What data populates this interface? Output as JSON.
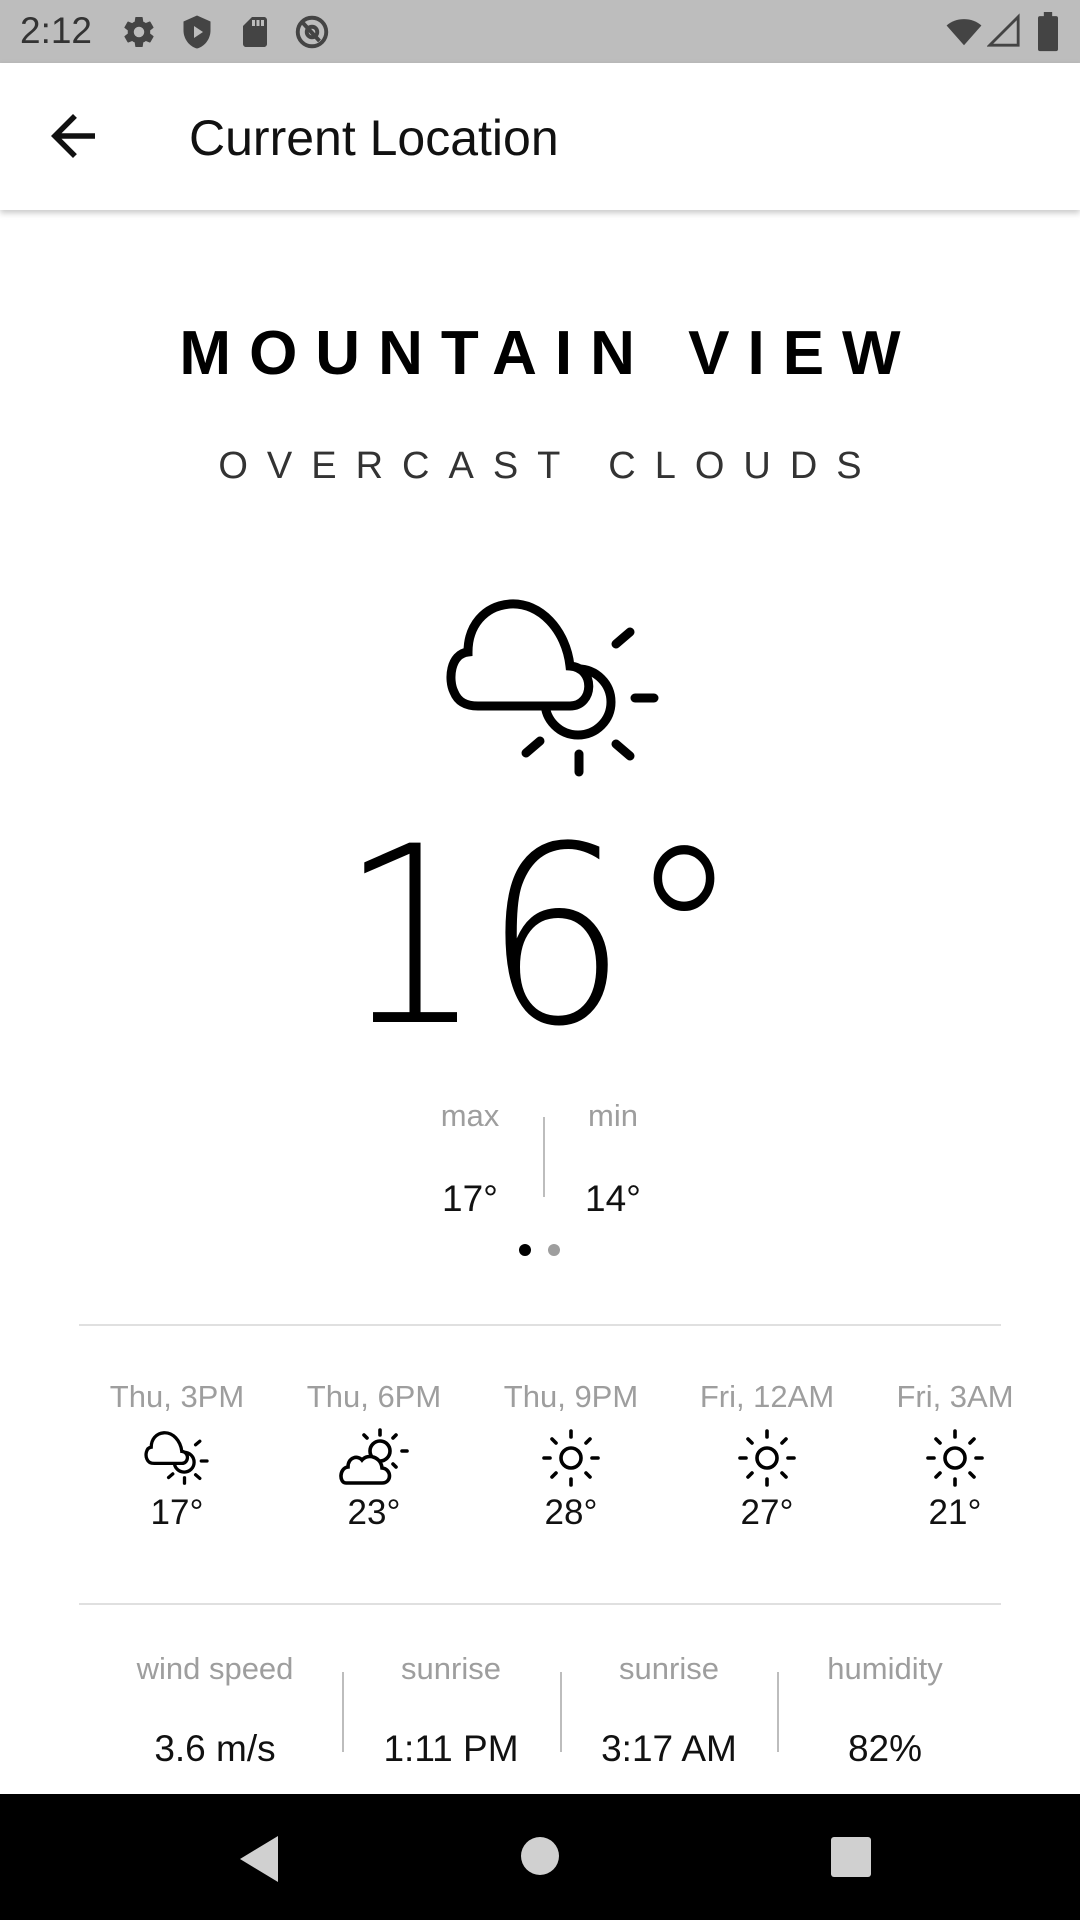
{
  "status_bar": {
    "time": "2:12",
    "icons_left": [
      "gear-icon",
      "shield-icon",
      "sd-card-icon",
      "at-sign-icon"
    ],
    "icons_right": [
      "wifi-icon",
      "signal-icon",
      "battery-icon"
    ],
    "background": "#bdbdbd"
  },
  "app_bar": {
    "back_icon": "arrow-back-icon",
    "title": "Current Location"
  },
  "current": {
    "city": "MOUNTAIN VIEW",
    "description": "OVERCAST CLOUDS",
    "icon": "cloud-sun-icon",
    "temperature": "16°",
    "max_label": "max",
    "max_value": "17°",
    "min_label": "min",
    "min_value": "14°"
  },
  "pager": {
    "page_count": 2,
    "active_index": 0,
    "active_color": "#000000",
    "inactive_color": "#9e9e9e"
  },
  "forecast": [
    {
      "time": "Thu, 3PM",
      "icon": "cloud-sun-icon",
      "temp": "17°"
    },
    {
      "time": "Thu, 6PM",
      "icon": "partly-cloudy-icon",
      "temp": "23°"
    },
    {
      "time": "Thu, 9PM",
      "icon": "sun-icon",
      "temp": "28°"
    },
    {
      "time": "Fri, 12AM",
      "icon": "sun-icon",
      "temp": "27°"
    },
    {
      "time": "Fri, 3AM",
      "icon": "sun-icon",
      "temp": "21°"
    }
  ],
  "details": [
    {
      "label": "wind speed",
      "value": "3.6 m/s"
    },
    {
      "label": "sunrise",
      "value": "1:11 PM"
    },
    {
      "label": "sunrise",
      "value": "3:17 AM"
    },
    {
      "label": "humidity",
      "value": "82%"
    }
  ],
  "nav_bar": {
    "buttons": [
      "back-triangle-icon",
      "home-circle-icon",
      "recents-square-icon"
    ],
    "background": "#000000"
  }
}
